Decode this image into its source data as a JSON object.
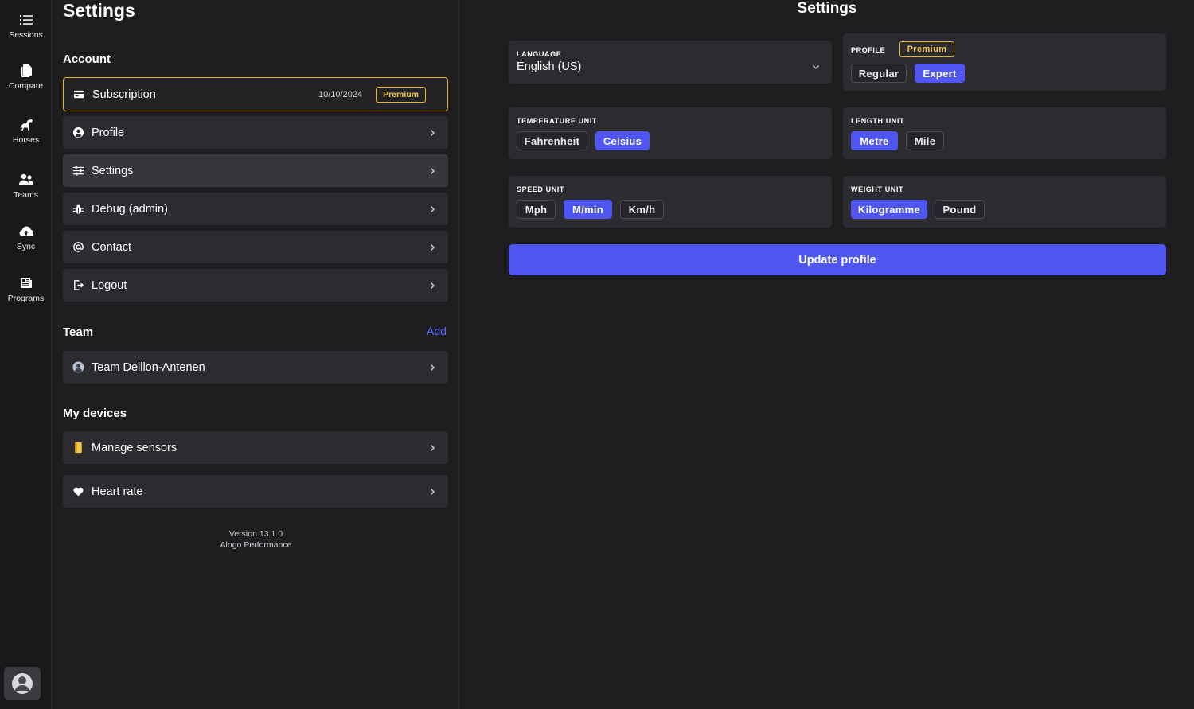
{
  "rail": {
    "items": [
      {
        "label": "Sessions",
        "icon": "list-icon"
      },
      {
        "label": "Compare",
        "icon": "documents-icon"
      },
      {
        "label": "Horses",
        "icon": "horse-icon"
      },
      {
        "label": "Teams",
        "icon": "users-icon"
      },
      {
        "label": "Sync",
        "icon": "cloud-upload-icon"
      },
      {
        "label": "Programs",
        "icon": "newspaper-icon"
      }
    ],
    "avatar": "user-avatar"
  },
  "menu": {
    "title": "Settings",
    "account_heading": "Account",
    "subscription": {
      "label": "Subscription",
      "date": "10/10/2024",
      "badge": "Premium"
    },
    "account_items": [
      {
        "label": "Profile",
        "icon": "user-circle-icon"
      },
      {
        "label": "Settings",
        "icon": "sliders-icon"
      },
      {
        "label": "Debug (admin)",
        "icon": "bug-icon"
      },
      {
        "label": "Contact",
        "icon": "at-icon"
      },
      {
        "label": "Logout",
        "icon": "logout-icon"
      }
    ],
    "team_heading": "Team",
    "team_add": "Add",
    "team_items": [
      {
        "label": "Team Deillon-Antenen",
        "icon": "team-avatar"
      }
    ],
    "devices_heading": "My devices",
    "device_items": [
      {
        "label": "Manage sensors",
        "icon": "sensor-icon"
      },
      {
        "label": "Heart rate",
        "icon": "heart-icon"
      }
    ],
    "version": "Version 13.1.0",
    "company": "Alogo Performance"
  },
  "settings": {
    "title": "Settings",
    "language": {
      "caption": "LANGUAGE",
      "value": "English (US)"
    },
    "profile": {
      "caption": "PROFILE",
      "badge": "Premium",
      "options": [
        "Regular",
        "Expert"
      ],
      "selected": "Expert"
    },
    "temperature": {
      "caption": "TEMPERATURE UNIT",
      "options": [
        "Fahrenheit",
        "Celsius"
      ],
      "selected": "Celsius"
    },
    "length": {
      "caption": "LENGTH UNIT",
      "options": [
        "Metre",
        "Mile"
      ],
      "selected": "Metre"
    },
    "speed": {
      "caption": "SPEED UNIT",
      "options": [
        "Mph",
        "M/min",
        "Km/h"
      ],
      "selected": "M/min"
    },
    "weight": {
      "caption": "WEIGHT UNIT",
      "options": [
        "Kilogramme",
        "Pound"
      ],
      "selected": "Kilogramme"
    },
    "update_button": "Update profile"
  },
  "colors": {
    "accent": "#4f55f1",
    "premium": "#e5b92a",
    "background": "#1e1e21",
    "card": "#2c2c30"
  }
}
